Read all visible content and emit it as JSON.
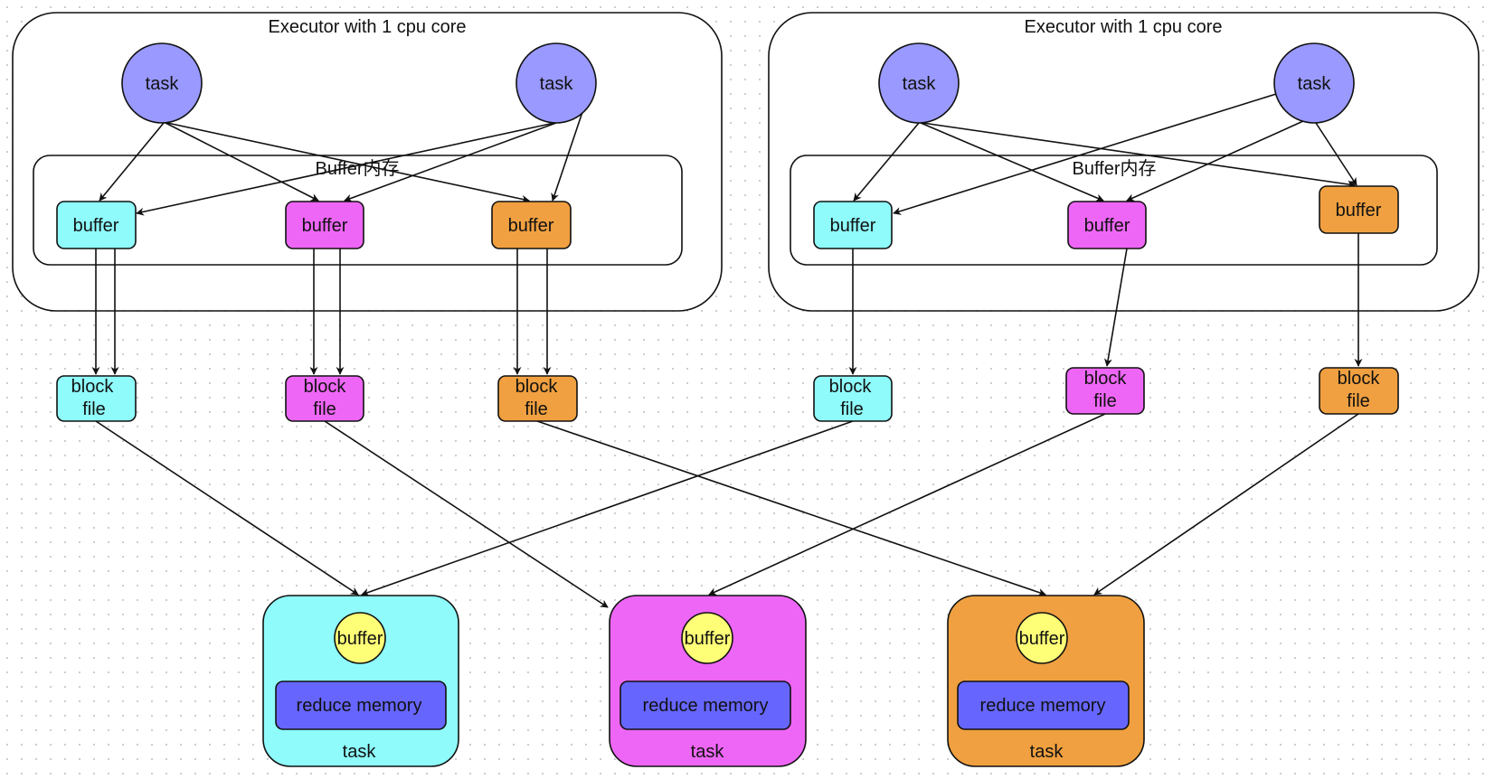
{
  "colors": {
    "task": "#9999ff",
    "cyan": "#8ffbfb",
    "magenta": "#ee66f5",
    "orange": "#f0a040",
    "reduce_buffer": "#ffff77",
    "reduce_memory": "#6666ff",
    "stroke": "#111111"
  },
  "executors": [
    {
      "title": "Executor with 1 cpu core",
      "buffer_region_label": "Buffer内存",
      "tasks": [
        {
          "label": "task"
        },
        {
          "label": "task"
        }
      ],
      "buffers": [
        {
          "label": "buffer",
          "color": "cyan"
        },
        {
          "label": "buffer",
          "color": "magenta"
        },
        {
          "label": "buffer",
          "color": "orange"
        }
      ],
      "block_files": [
        {
          "line1": "block",
          "line2": "file",
          "color": "cyan"
        },
        {
          "line1": "block",
          "line2": "file",
          "color": "magenta"
        },
        {
          "line1": "block",
          "line2": "file",
          "color": "orange"
        }
      ]
    },
    {
      "title": "Executor with 1 cpu core",
      "buffer_region_label": "Buffer内存",
      "tasks": [
        {
          "label": "task"
        },
        {
          "label": "task"
        }
      ],
      "buffers": [
        {
          "label": "buffer",
          "color": "cyan"
        },
        {
          "label": "buffer",
          "color": "magenta"
        },
        {
          "label": "buffer",
          "color": "orange"
        }
      ],
      "block_files": [
        {
          "line1": "block",
          "line2": "file",
          "color": "cyan"
        },
        {
          "line1": "block",
          "line2": "file",
          "color": "magenta"
        },
        {
          "line1": "block",
          "line2": "file",
          "color": "orange"
        }
      ]
    }
  ],
  "reduce_tasks": [
    {
      "buffer_label": "buffer",
      "memory_label": "reduce memory",
      "task_label": "task",
      "color": "cyan"
    },
    {
      "buffer_label": "buffer",
      "memory_label": "reduce memory",
      "task_label": "task",
      "color": "magenta"
    },
    {
      "buffer_label": "buffer",
      "memory_label": "reduce memory",
      "task_label": "task",
      "color": "orange"
    }
  ]
}
